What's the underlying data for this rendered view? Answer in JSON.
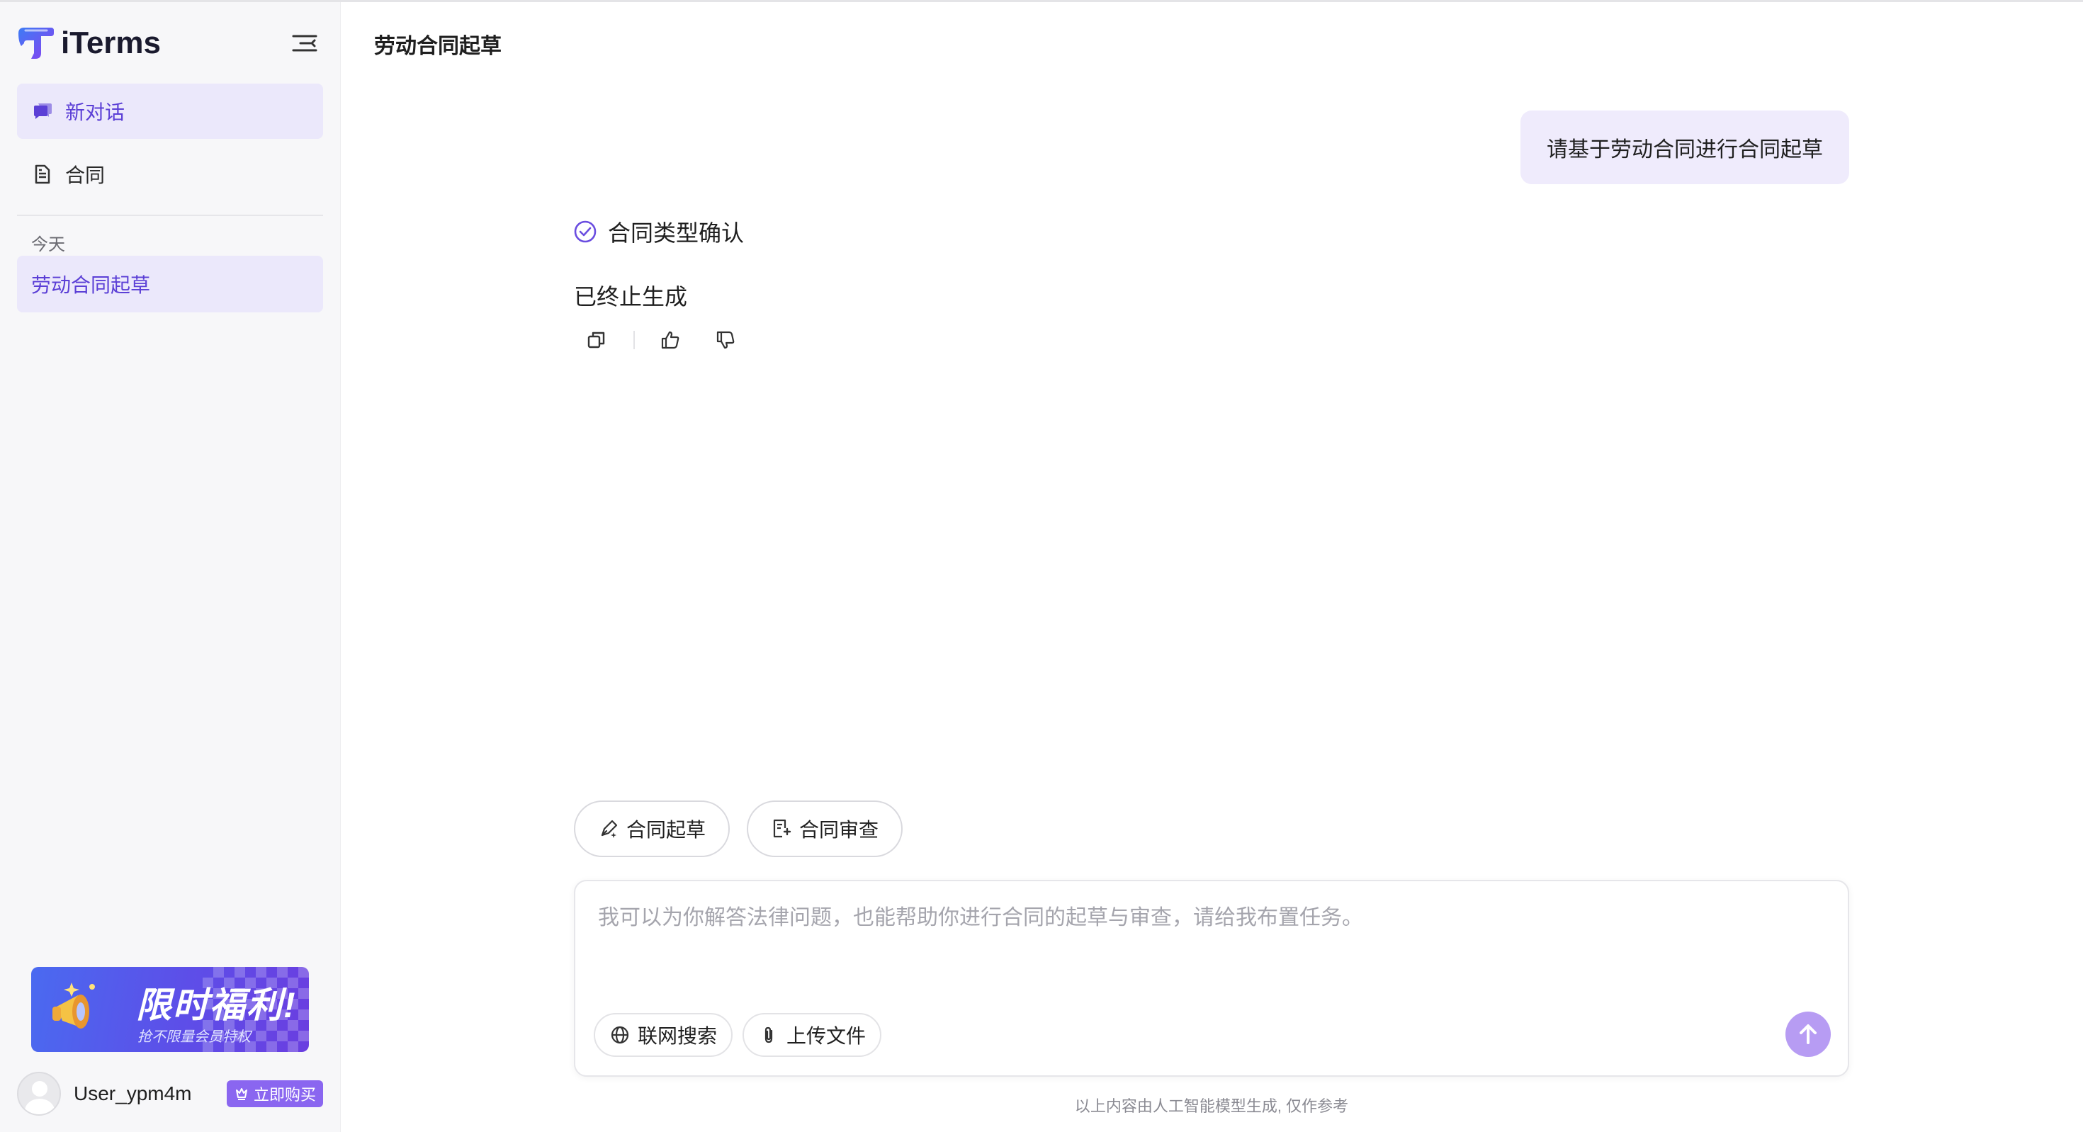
{
  "app": {
    "name": "iTerms"
  },
  "sidebar": {
    "nav": [
      {
        "label": "新对话",
        "icon": "chat-bubble-icon",
        "active": true
      },
      {
        "label": "合同",
        "icon": "document-icon",
        "active": false
      }
    ],
    "section_title": "今天",
    "history": [
      {
        "label": "劳动合同起草",
        "active": true
      }
    ],
    "promo": {
      "title": "限时福利!",
      "subtitle": "抢不限量会员特权"
    },
    "user": {
      "name": "User_ypm4m",
      "buy_label": "立即购买"
    }
  },
  "main": {
    "title": "劳动合同起草",
    "messages": {
      "user_text": "请基于劳动合同进行合同起草",
      "step_label": "合同类型确认",
      "answer_text": "已终止生成"
    },
    "message_actions": [
      "copy-icon",
      "thumbs-up-icon",
      "thumbs-down-icon"
    ],
    "chips": [
      {
        "label": "合同起草",
        "icon": "pen-sparkle-icon"
      },
      {
        "label": "合同审查",
        "icon": "document-review-icon"
      }
    ],
    "composer": {
      "placeholder": "我可以为你解答法律问题，也能帮助你进行合同的起草与审查，请给我布置任务。",
      "tools": [
        {
          "label": "联网搜索",
          "icon": "globe-icon"
        },
        {
          "label": "上传文件",
          "icon": "paperclip-icon"
        }
      ]
    },
    "disclaimer": "以上内容由人工智能模型生成, 仅作参考"
  },
  "colors": {
    "accent": "#5b3fd6",
    "accent_light": "#ebe8fb",
    "send_button": "#b79cf3",
    "sidebar_bg": "#f7f7f9"
  }
}
